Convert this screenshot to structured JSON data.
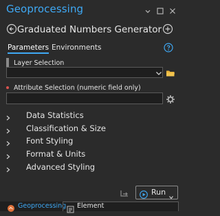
{
  "window": {
    "title": "Geoprocessing",
    "accent": "#3fa9f5",
    "controls": {
      "menu": "chevron-down-icon",
      "close": "close-icon"
    }
  },
  "tool": {
    "title": "Graduated Numbers Generator",
    "back_icon": "back-circle-icon",
    "add_icon": "plus-circle-icon"
  },
  "tabs": [
    {
      "label": "Parameters",
      "active": true
    },
    {
      "label": "Environments",
      "active": false
    }
  ],
  "help_icon": "help-icon",
  "params": {
    "layer_selection": {
      "label": "Layer Selection",
      "value": "",
      "dropdown_icon": "chevron-down-icon",
      "browse_icon": "folder-icon"
    },
    "attribute_selection": {
      "label": "Attribute Selection (numeric field only)",
      "value": "",
      "settings_icon": "gear-icon"
    }
  },
  "sections": [
    {
      "label": "Data Statistics"
    },
    {
      "label": "Classification & Size"
    },
    {
      "label": "Font Styling"
    },
    {
      "label": "Format & Units"
    },
    {
      "label": "Advanced Styling"
    }
  ],
  "run": {
    "label": "Run"
  },
  "footer": {
    "tabs": [
      {
        "label": "Geoprocessing",
        "active": true
      },
      {
        "label": "Element",
        "active": false
      }
    ]
  }
}
